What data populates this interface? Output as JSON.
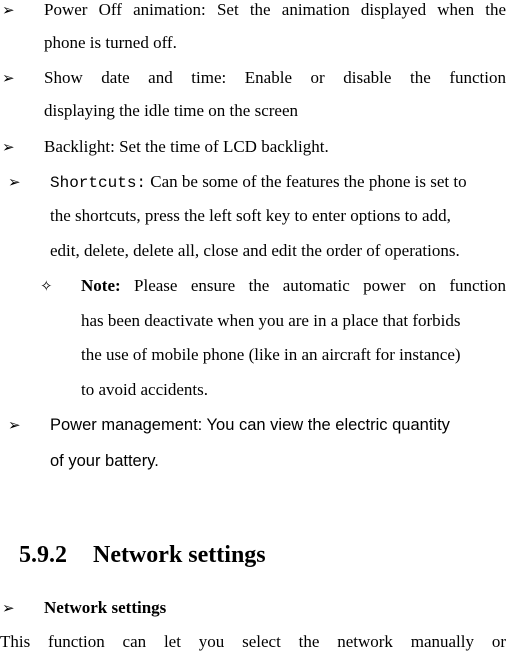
{
  "items": [
    {
      "bullet_icon": "arrowhead-bullet",
      "lines": [
        "Power Off animation: Set the animation displayed when the",
        "phone is turned off."
      ]
    },
    {
      "bullet_icon": "arrowhead-bullet",
      "lines": [
        "Show date and time: Enable or disable the function",
        "displaying the idle time on the screen"
      ]
    },
    {
      "bullet_icon": "arrowhead-bullet",
      "lines": [
        "Backlight: Set the time of LCD backlight."
      ]
    },
    {
      "bullet_icon": "arrowhead-bullet",
      "term": "Shortcuts:",
      "lines": [
        " Can be some of the features the phone is set to",
        "the shortcuts, press the left soft key to enter options to add,",
        "edit, delete, delete all, close and edit the order of operations."
      ]
    },
    {
      "bullet_icon": "diamond-star-bullet",
      "term": "Note:",
      "lines": [
        " Please ensure the automatic power on function",
        "has been deactivate when you are in a place that forbids",
        "the use of mobile phone (like in an aircraft for instance)",
        "to avoid accidents."
      ]
    },
    {
      "bullet_icon": "arrowhead-bullet",
      "lines": [
        "Power management: You can view the electric quantity",
        "of your battery."
      ]
    }
  ],
  "section": {
    "number": "5.9.2",
    "title": "Network settings"
  },
  "subsection": {
    "bullet_icon": "arrowhead-bullet",
    "title": "Network settings"
  },
  "body_text": "This function can let you select the network manually or",
  "glyphs": {
    "arrow": "➢",
    "star": "✧"
  }
}
